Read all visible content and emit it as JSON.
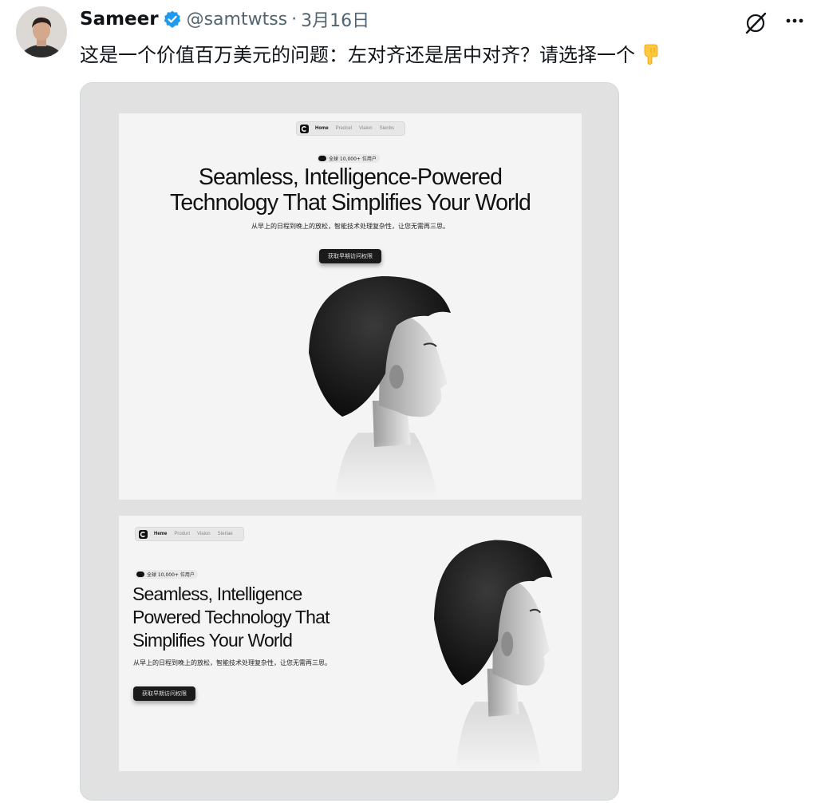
{
  "tweet": {
    "author_name": "Sameer",
    "handle": "@samtwtss",
    "separator": "·",
    "date": "3月16日",
    "text": "这是一个价值百万美元的问题：左对齐还是居中对齐？请选择一个",
    "emoji": "pointing-down-emoji"
  },
  "icons": {
    "grok": "grok-icon",
    "more": "more-icon",
    "verified": "verified-badge-icon"
  },
  "colors": {
    "verified_blue": "#1d9bf0",
    "text_secondary": "#536471",
    "mock_bg": "#f4f4f4"
  },
  "mockups": {
    "centered": {
      "nav": [
        "Home",
        "Predcel",
        "Viaion",
        "Sienbs"
      ],
      "badge": "全球 10,000+ 位用户",
      "headline_lines": [
        "Seamless, Intelligence-Powered",
        "Technology That Simplifies Your World"
      ],
      "subtitle": "从早上的日程到晚上的放松，智能技术处理复杂性，让您无需再三思。",
      "cta": "获取早期访问权限"
    },
    "left": {
      "nav": [
        "Heme",
        "Produrt",
        "Viaion",
        "Sterlae"
      ],
      "badge": "全球 10,000+ 位用户",
      "headline_lines": [
        "Seamless, Intelligence",
        "Powered Technology That",
        "Simplifies Your World"
      ],
      "subtitle": "从早上的日程到晚上的放松，智能技术处理复杂性，让您无需再三思。",
      "cta": "获取早期访问权限"
    }
  }
}
